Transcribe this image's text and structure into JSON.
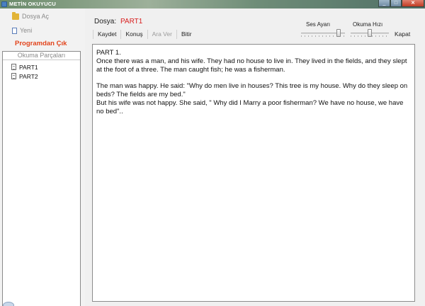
{
  "window": {
    "title": "METİN OKUYUCU",
    "controls": {
      "minimize": "_",
      "maximize": "□",
      "close": "✕"
    }
  },
  "sidebar": {
    "open_file": {
      "label": "Dosya Aç",
      "icon": "folder-open-icon"
    },
    "new": {
      "label": "Yeni",
      "icon": "document-icon"
    },
    "exit": {
      "label": "Programdan Çık"
    },
    "parts_header": "Okuma Parçaları",
    "parts": [
      {
        "label": "PART1"
      },
      {
        "label": "PART2"
      }
    ]
  },
  "file": {
    "label": "Dosya:",
    "name": "PART1"
  },
  "toolbar": {
    "save": "Kaydet",
    "speak": "Konuş",
    "pause": "Ara Ver",
    "finish": "Bitir"
  },
  "volume": {
    "label": "Ses Ayarı",
    "level": 0.9
  },
  "speed": {
    "label": "Okuma Hızı",
    "level": 0.5
  },
  "close_label": "Kapat",
  "reader": {
    "paragraphs": [
      "PART 1.",
      "Once there was a man, and his wife. They had no house to live in. They lived  in the fields, and they slept at the foot of a three. The man caught fish; he was a fisherman.",
      "The man was happy. He said: \"Why do men live in houses? This tree is my house. Why do they sleep on beds? The fields are my bed.\"",
      "But his wife was not happy. She said, \" Why did I Marry a poor fisherman? We have no house, we have no bed\".."
    ]
  }
}
